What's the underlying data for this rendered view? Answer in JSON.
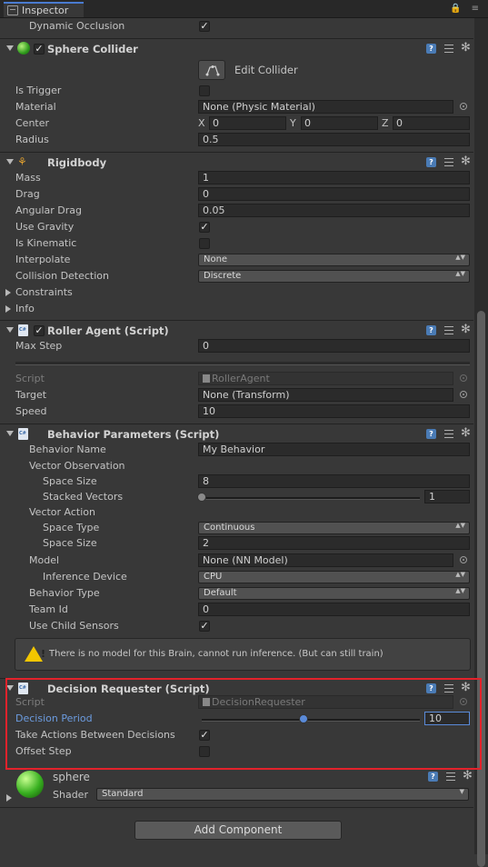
{
  "window": {
    "tab_title": "Inspector",
    "tab_icons": "🔒 ≡"
  },
  "top": {
    "dynamic_occlusion_label": "Dynamic Occlusion",
    "dynamic_occlusion_check": "✓"
  },
  "sphere_collider": {
    "title": "Sphere Collider",
    "edit_collider_label": "Edit Collider",
    "is_trigger_label": "Is Trigger",
    "material_label": "Material",
    "material_value": "None (Physic Material)",
    "center_label": "Center",
    "center_x_label": "X",
    "center_x": "0",
    "center_y_label": "Y",
    "center_y": "0",
    "center_z_label": "Z",
    "center_z": "0",
    "radius_label": "Radius",
    "radius_value": "0.5"
  },
  "rigidbody": {
    "title": "Rigidbody",
    "mass_label": "Mass",
    "mass_value": "1",
    "drag_label": "Drag",
    "drag_value": "0",
    "angular_drag_label": "Angular Drag",
    "angular_drag_value": "0.05",
    "use_gravity_label": "Use Gravity",
    "use_gravity_check": "✓",
    "is_kinematic_label": "Is Kinematic",
    "interpolate_label": "Interpolate",
    "interpolate_value": "None",
    "collision_label": "Collision Detection",
    "collision_value": "Discrete",
    "constraints_label": "Constraints",
    "info_label": "Info"
  },
  "roller_agent": {
    "title": "Roller Agent (Script)",
    "max_step_label": "Max Step",
    "max_step_value": "0",
    "script_label": "Script",
    "script_value": "RollerAgent",
    "target_label": "Target",
    "target_value": "None (Transform)",
    "speed_label": "Speed",
    "speed_value": "10"
  },
  "behavior": {
    "title": "Behavior Parameters (Script)",
    "behavior_name_label": "Behavior Name",
    "behavior_name_value": "My Behavior",
    "vector_obs_label": "Vector Observation",
    "space_size_label": "Space Size",
    "space_size_value": "8",
    "stacked_label": "Stacked Vectors",
    "stacked_value": "1",
    "vector_action_label": "Vector Action",
    "space_type_label": "Space Type",
    "space_type_value": "Continuous",
    "action_size_label": "Space Size",
    "action_size_value": "2",
    "model_label": "Model",
    "model_value": "None (NN Model)",
    "inference_label": "Inference Device",
    "inference_value": "CPU",
    "behavior_type_label": "Behavior Type",
    "behavior_type_value": "Default",
    "team_id_label": "Team Id",
    "team_id_value": "0",
    "child_sensors_label": "Use Child Sensors",
    "child_sensors_check": "✓",
    "warning": "There is no model for this Brain, cannot run inference. (But can still train)",
    "warning_mark": "!"
  },
  "decision_requester": {
    "title": "Decision Requester (Script)",
    "script_label": "Script",
    "script_value": "DecisionRequester",
    "period_label": "Decision Period",
    "period_value": "10",
    "take_actions_label": "Take Actions Between Decisions",
    "take_actions_check": "✓",
    "offset_label": "Offset Step"
  },
  "material": {
    "name": "sphere",
    "shader_label": "Shader",
    "shader_value": "Standard"
  },
  "add_component": "Add Component",
  "icons": {
    "help": "?",
    "gear": "✻",
    "dropdown_arrow": "▲▼"
  },
  "colors": {
    "accent": "#4a7bd0",
    "highlight_box": "#e3222b",
    "warning": "#f2c600"
  }
}
